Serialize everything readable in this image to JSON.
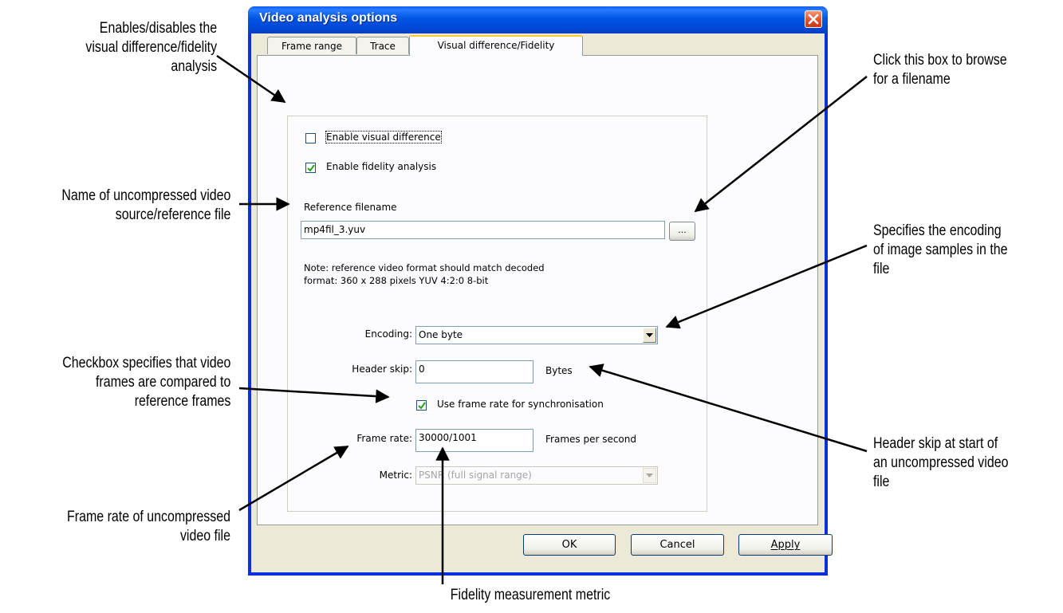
{
  "dialog": {
    "title": "Video analysis options",
    "tabs": [
      "Frame range",
      "Trace",
      "Visual difference/Fidelity"
    ],
    "enable_visual_difference": {
      "label": "Enable visual difference",
      "checked": false
    },
    "enable_fidelity_analysis": {
      "label": "Enable fidelity analysis",
      "checked": true
    },
    "reference_filename_label": "Reference filename",
    "reference_filename_value": "mp4fil_3.yuv",
    "browse_label": "...",
    "note_line1": "Note: reference video format should match decoded",
    "note_line2": "format: 360 x 288 pixels YUV 4:2:0 8-bit",
    "encoding_label": "Encoding:",
    "encoding_value": "One byte",
    "header_skip_label": "Header skip:",
    "header_skip_value": "0",
    "header_skip_unit": "Bytes",
    "use_frame_rate": {
      "label": "Use frame rate for synchronisation",
      "checked": true
    },
    "frame_rate_label": "Frame rate:",
    "frame_rate_value": "30000/1001",
    "frame_rate_unit": "Frames per second",
    "metric_label": "Metric:",
    "metric_value": "PSNR (full signal range)",
    "buttons": {
      "ok": "OK",
      "cancel": "Cancel",
      "apply": "Apply"
    }
  },
  "annotations": {
    "enable_toggle": [
      "Enables/disables the",
      "visual difference/fidelity",
      "analysis"
    ],
    "reference_name": [
      "Name of uncompressed video",
      "source/reference file"
    ],
    "checkbox_sync": [
      "Checkbox specifies that video",
      "frames are compared to",
      "reference frames"
    ],
    "frame_rate": [
      "Frame rate of uncompressed",
      "video file"
    ],
    "browse": [
      "Click this box to browse",
      "for a filename"
    ],
    "encoding": [
      "Specifies the encoding",
      "of image samples in the",
      "file"
    ],
    "header_skip": [
      "Header skip at start of",
      "an uncompressed video",
      "file"
    ],
    "metric": [
      "Fidelity measurement metric"
    ]
  }
}
